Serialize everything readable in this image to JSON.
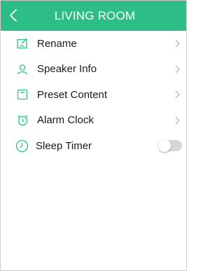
{
  "header": {
    "title": "LIVING ROOM",
    "background_color": "#2dbd87"
  },
  "menu": {
    "items": [
      {
        "label": "Rename",
        "icon": "edit-icon",
        "has_chevron": true
      },
      {
        "label": "Speaker Info",
        "icon": "user-icon",
        "has_chevron": true
      },
      {
        "label": "Preset Content",
        "icon": "preset-icon",
        "has_chevron": true
      },
      {
        "label": "Alarm Clock",
        "icon": "alarm-clock-icon",
        "has_chevron": true
      }
    ],
    "sleep_timer": {
      "label": "Sleep Timer",
      "icon": "timer-icon",
      "enabled": false
    }
  },
  "colors": {
    "accent": "#2dbd87",
    "chevron": "#b0b0b0",
    "toggle_off": "#d6d6d6"
  }
}
